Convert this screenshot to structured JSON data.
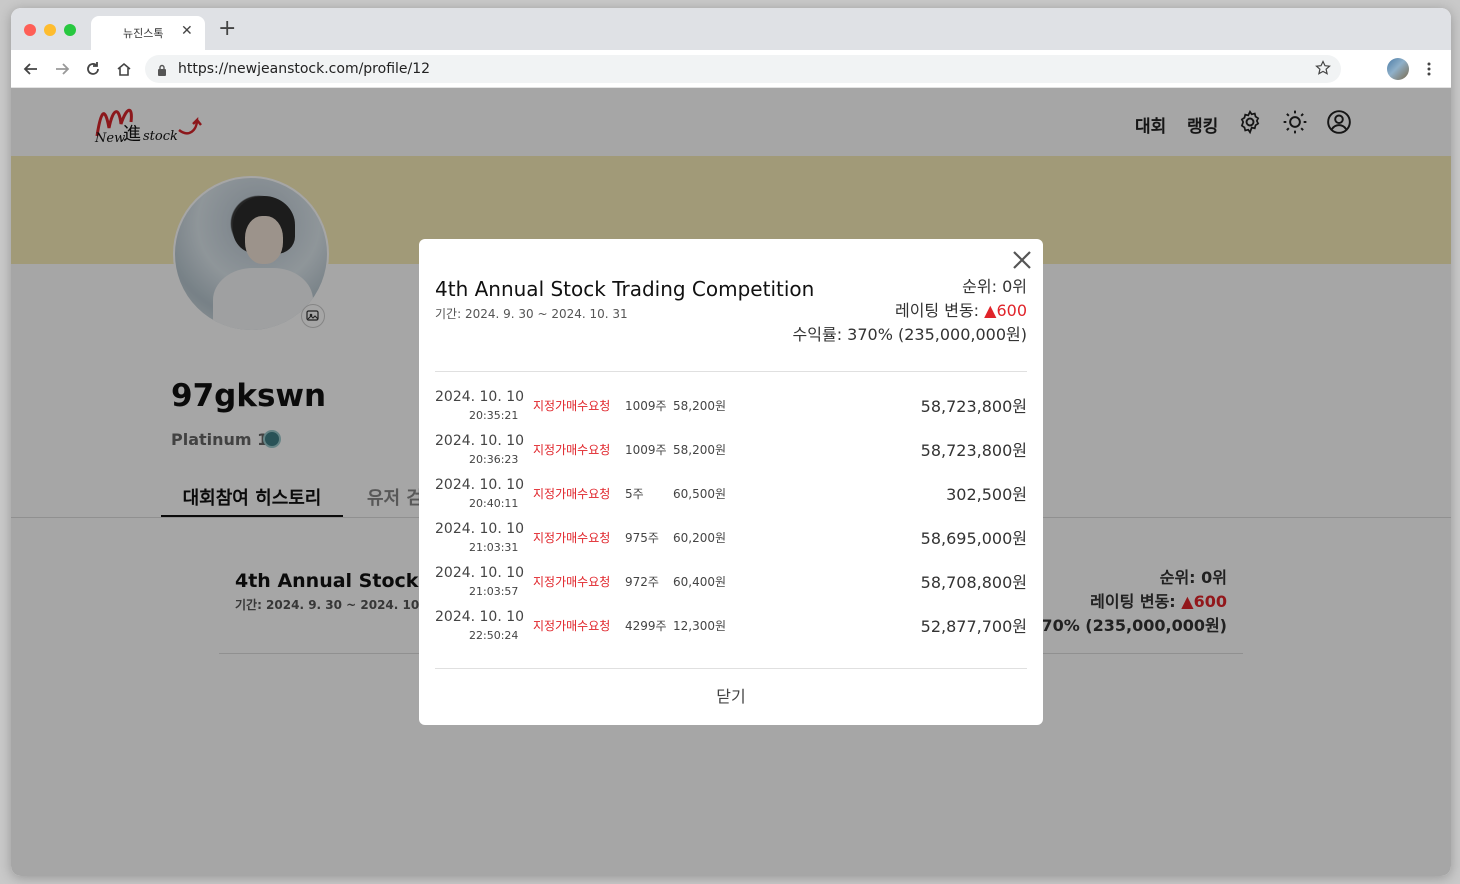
{
  "browser": {
    "tab_title": "뉴진스톡",
    "url": "https://newjeanstock.com/profile/12"
  },
  "header": {
    "logo_text": "New進stock",
    "nav": [
      "대회",
      "랭킹"
    ]
  },
  "profile": {
    "username": "97gkswn",
    "tier": "Platinum 1",
    "tabs": [
      "대회참여 히스토리",
      "유저 검색"
    ]
  },
  "card": {
    "title": "4th Annual Stock Trading Competition",
    "period": "기간: 2024. 9. 30 ~ 2024. 10. 31",
    "rank": "순위: 0위",
    "rating_label": "레이팅 변동:",
    "rating_value": "▲600",
    "profit": "수익률: 370% (235,000,000원)"
  },
  "modal": {
    "title": "4th Annual Stock Trading Competition",
    "period": "기간: 2024. 9. 30 ~ 2024. 10. 31",
    "rank": "순위: 0위",
    "rating_label": "레이팅 변동:",
    "rating_value": "▲600",
    "profit": "수익률: 370% (235,000,000원)",
    "close_label": "닫기",
    "transactions": [
      {
        "date": "2024. 10. 10",
        "time": "20:35:21",
        "type": "지정가매수요청",
        "qty": "1009주",
        "price": "58,200원",
        "total": "58,723,800원"
      },
      {
        "date": "2024. 10. 10",
        "time": "20:36:23",
        "type": "지정가매수요청",
        "qty": "1009주",
        "price": "58,200원",
        "total": "58,723,800원"
      },
      {
        "date": "2024. 10. 10",
        "time": "20:40:11",
        "type": "지정가매수요청",
        "qty": "5주",
        "price": "60,500원",
        "total": "302,500원"
      },
      {
        "date": "2024. 10. 10",
        "time": "21:03:31",
        "type": "지정가매수요청",
        "qty": "975주",
        "price": "60,200원",
        "total": "58,695,000원"
      },
      {
        "date": "2024. 10. 10",
        "time": "21:03:57",
        "type": "지정가매수요청",
        "qty": "972주",
        "price": "60,400원",
        "total": "58,708,800원"
      },
      {
        "date": "2024. 10. 10",
        "time": "22:50:24",
        "type": "지정가매수요청",
        "qty": "4299주",
        "price": "12,300원",
        "total": "52,877,700원"
      }
    ]
  },
  "colors": {
    "accent_red": "#e0242a",
    "banner": "#f7edb9"
  }
}
